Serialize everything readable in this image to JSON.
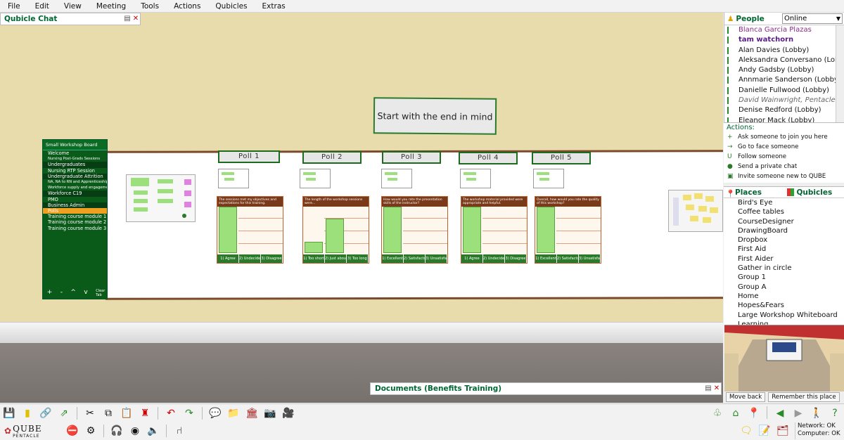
{
  "menu": [
    "File",
    "Edit",
    "View",
    "Meeting",
    "Tools",
    "Actions",
    "Qubicles",
    "Extras"
  ],
  "chat_panel": {
    "title": "Qubicle Chat"
  },
  "banner": {
    "text": "Start with the end in mind"
  },
  "board": {
    "title": "Small Workshop Board",
    "items": [
      {
        "label": "Welcome",
        "style": ""
      },
      {
        "label": "Nursing Post-Grads Sessions",
        "style": "small"
      },
      {
        "label": "Undergraduates",
        "style": "dark"
      },
      {
        "label": "Nursing RTP Session",
        "style": ""
      },
      {
        "label": "Undergraduate Attrition",
        "style": "dark"
      },
      {
        "label": "NA, NA to RN and Apprenticeships",
        "style": "small"
      },
      {
        "label": "Workforce supply and engagement",
        "style": "small"
      },
      {
        "label": "Workforce C19",
        "style": "dark"
      },
      {
        "label": "PMO",
        "style": ""
      },
      {
        "label": "Business Admin",
        "style": "dark"
      },
      {
        "label": "Polls",
        "style": "hl"
      },
      {
        "label": "Training course module 1",
        "style": ""
      },
      {
        "label": "Training course module 2",
        "style": ""
      },
      {
        "label": "Training course module 3",
        "style": ""
      }
    ],
    "controls": [
      "+",
      "-",
      "^",
      "v",
      "Clear Tab"
    ]
  },
  "polls": [
    {
      "title": "Poll 1",
      "head": "The sessions met my objectives and expectations for this training.",
      "footer": [
        "1) Agree",
        "2) Undecided",
        "3) Disagree"
      ],
      "bars": [
        1.0,
        0,
        0
      ]
    },
    {
      "title": "Poll 2",
      "head": "The length of the workshop sessions were...",
      "footer": [
        "1) Too short",
        "2) Just about right",
        "3) Too long"
      ],
      "bars": [
        0.25,
        0.75,
        0
      ]
    },
    {
      "title": "Poll 3",
      "head": "How would you rate the presentation skills of the instructor?",
      "footer": [
        "1) Excellent",
        "2) Satisfactory",
        "3) Unsatisfactory"
      ],
      "bars": [
        1.0,
        0,
        0
      ]
    },
    {
      "title": "Poll 4",
      "head": "The workshop material provided were appropriate and helpful.",
      "footer": [
        "1) Agree",
        "2) Undecided",
        "3) Disagree"
      ],
      "bars": [
        1.0,
        0,
        0
      ]
    },
    {
      "title": "Poll 5",
      "head": "Overall, how would you rate the quality of this workshop?",
      "footer": [
        "1) Excellent",
        "2) Satisfactory",
        "3) Unsatisfactory"
      ],
      "bars": [
        1.0,
        0,
        0
      ]
    }
  ],
  "docs_panel": {
    "title": "Documents (Benefits Training)"
  },
  "people": {
    "title": "People",
    "status": "Online",
    "list": [
      {
        "name": "Blanca Garcia Plazas",
        "kind": "current"
      },
      {
        "name": "tam watchorn",
        "kind": "self"
      },
      {
        "name": "Alan Davies (Lobby)",
        "kind": ""
      },
      {
        "name": "Aleksandra Conversano (Lobby)",
        "kind": ""
      },
      {
        "name": "Andy Gadsby (Lobby)",
        "kind": ""
      },
      {
        "name": "Annmarie Sanderson (Lobby)",
        "kind": ""
      },
      {
        "name": "Danielle Fullwood (Lobby)",
        "kind": ""
      },
      {
        "name": "David Wainwright, Pentacle (L",
        "kind": "away"
      },
      {
        "name": "Denise Redford (Lobby)",
        "kind": ""
      },
      {
        "name": "Eleanor Mack (Lobby)",
        "kind": ""
      }
    ]
  },
  "actions": {
    "title": "Actions:",
    "list": [
      {
        "label": "Ask someone to join you here",
        "icon": "+"
      },
      {
        "label": "Go to face someone",
        "icon": "→"
      },
      {
        "label": "Follow someone",
        "icon": "U"
      },
      {
        "label": "Send a private chat",
        "icon": "●"
      },
      {
        "label": "Invite someone new to QUBE",
        "icon": "▣"
      }
    ]
  },
  "places": {
    "tab_places": "Places",
    "tab_qubicles": "Qubicles",
    "list": [
      "Bird's Eye",
      "Coffee tables",
      "CourseDesigner",
      "DrawingBoard",
      "Dropbox",
      "First Aid",
      "First Aider",
      "Gather in circle",
      "Group 1",
      "Group A",
      "Home",
      "Hopes&Fears",
      "Large Workshop Whiteboard",
      "Learning"
    ]
  },
  "nav": {
    "back": "Move back",
    "remember": "Remember this place"
  },
  "status": {
    "network": "Network: OK",
    "computer": "Computer: OK"
  },
  "logo": {
    "name": "QUBE",
    "sub": "PENTACLE"
  },
  "colors": {
    "brand_green": "#0a5a1a",
    "accent_orange": "#f0a020",
    "chart_head": "#7a3a1a",
    "bar_green": "#9be07a"
  }
}
